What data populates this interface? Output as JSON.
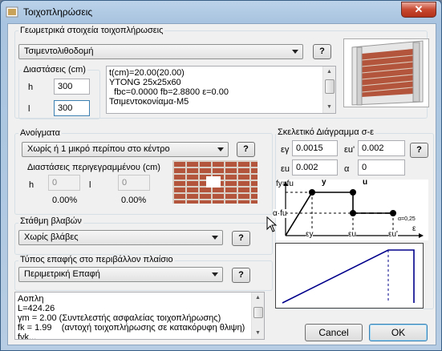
{
  "window": {
    "title": "Τοιχοπληρώσεις",
    "close_symbol": "✕"
  },
  "geometry": {
    "group_label": "Γεωμετρικά στοιχεία τοιχοπλήρωσεις",
    "material": "Τσιμεντολιθοδομή",
    "help_label": "?",
    "dims_label": "Διαστάσεις (cm)",
    "h_label": "h",
    "h_value": "300",
    "l_label": "l",
    "l_value": "300",
    "info_lines": [
      "t(cm)=20.00(20.00)",
      "YTONG 25x25x60",
      "  fbc=0.0000 fb=2.8800 ε=0.00",
      "Τσιμεντοκονίαμα-M5"
    ]
  },
  "openings": {
    "group_label": "Ανοίγματα",
    "selected": "Χωρίς ή 1 μικρό περίπου στο κέντρο",
    "help_label": "?",
    "dims_label": "Διαστάσεις περιγεγραμμένου (cm)",
    "h_label": "h",
    "h_value": "0",
    "h_pct": "0.00%",
    "l_label": "l",
    "l_value": "0",
    "l_pct": "0.00%"
  },
  "damage": {
    "group_label": "Στάθμη βλαβών",
    "selected": "Χωρίς βλάβες",
    "help_label": "?"
  },
  "contact": {
    "group_label": "Τύπος επαφής στο περιβάλλον πλαίσιο",
    "selected": "Περιμετρική Επαφή",
    "help_label": "?"
  },
  "skeleton": {
    "group_label": "Σκελετικό Διάγραμμα σ-ε",
    "ey_label": "εγ",
    "ey_value": "0.0015",
    "eu1_label": "εu'",
    "eu1_value": "0.002",
    "eu_label": "εu",
    "eu_value": "0.002",
    "a_label": "α",
    "a_value": "0",
    "help_label": "?",
    "diagram": {
      "fy_fu": "fy=fu",
      "y": "y",
      "u": "u",
      "afu": "α·fu",
      "a_note": "α=0,25",
      "ey": "εy",
      "eu": "εu",
      "eu_prime": "εu'",
      "e": "ε"
    }
  },
  "report_lines": [
    "Αοπλη",
    "L=424.26",
    "γm = 2.00 (Συντελεστής ασφαλείας τοιχοπλήρωσης)",
    "fk = 1.99    (αντοχή τοιχοπλήρωσης σε κατακόρυφη θλιψη)",
    "fvk..."
  ],
  "buttons": {
    "cancel": "Cancel",
    "ok": "OK"
  },
  "colors": {
    "frame": "#3a5f86",
    "brick": "#b3553c",
    "plot_line": "#00008b"
  }
}
